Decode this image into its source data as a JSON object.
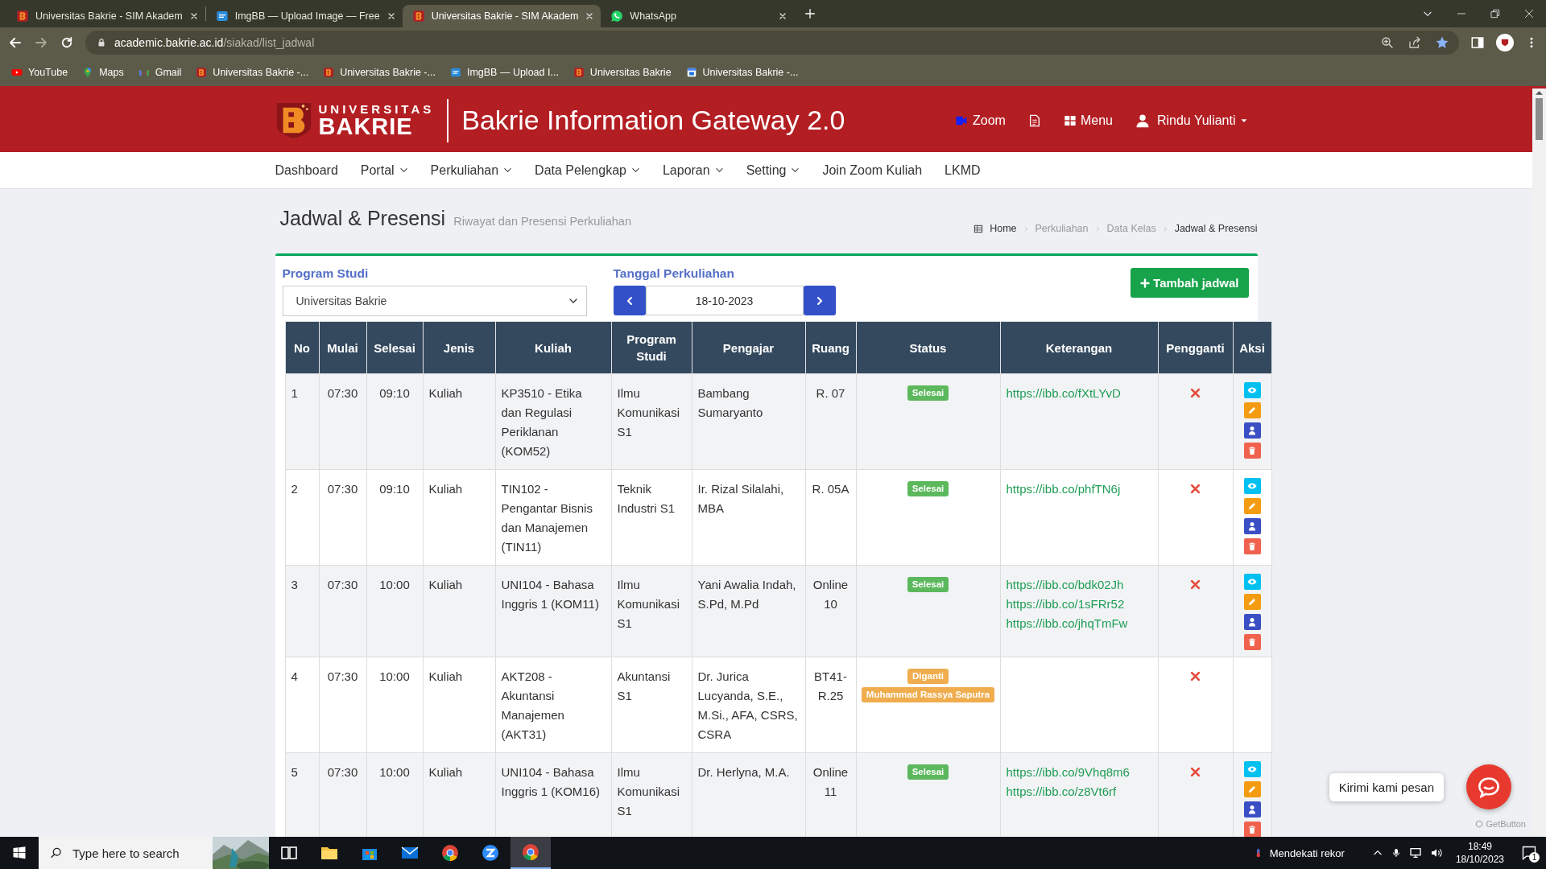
{
  "browser": {
    "tabs": [
      {
        "title": "Universitas Bakrie - SIM Akadem",
        "kind": "bakrie",
        "selected": false
      },
      {
        "title": "ImgBB — Upload Image — Free",
        "kind": "imgbb",
        "selected": false
      },
      {
        "title": "Universitas Bakrie - SIM Akadem",
        "kind": "bakrie",
        "selected": true
      },
      {
        "title": "WhatsApp",
        "kind": "whatsapp",
        "selected": false
      }
    ],
    "address": {
      "domain": "academic.bakrie.ac.id",
      "path": "/siakad/list_jadwal"
    },
    "bookmarks": [
      {
        "label": "YouTube",
        "kind": "youtube"
      },
      {
        "label": "Maps",
        "kind": "maps"
      },
      {
        "label": "Gmail",
        "kind": "gmail"
      },
      {
        "label": "Universitas Bakrie -...",
        "kind": "bakrie"
      },
      {
        "label": "Universitas Bakrie -...",
        "kind": "bakrie"
      },
      {
        "label": "ImgBB — Upload I...",
        "kind": "imgbb"
      },
      {
        "label": "Universitas Bakrie",
        "kind": "bakrie"
      },
      {
        "label": "Universitas Bakrie -...",
        "kind": "calendar"
      }
    ]
  },
  "header": {
    "logo": {
      "line1": "UNIVERSITAS",
      "line2": "BAKRIE"
    },
    "title": "Bakrie Information Gateway 2.0",
    "actions": [
      {
        "kind": "zoom",
        "label": "Zoom"
      },
      {
        "kind": "document"
      },
      {
        "kind": "menu",
        "label": "Menu"
      },
      {
        "kind": "user",
        "label": "Rindu Yulianti"
      }
    ]
  },
  "nav": [
    {
      "label": "Dashboard",
      "dropdown": false
    },
    {
      "label": "Portal",
      "dropdown": true
    },
    {
      "label": "Perkuliahan",
      "dropdown": true
    },
    {
      "label": "Data Pelengkap",
      "dropdown": true
    },
    {
      "label": "Laporan",
      "dropdown": true
    },
    {
      "label": "Setting",
      "dropdown": true
    },
    {
      "label": "Join Zoom Kuliah",
      "dropdown": false
    },
    {
      "label": "LKMD",
      "dropdown": false
    }
  ],
  "page": {
    "title": "Jadwal & Presensi",
    "subtitle": "Riwayat dan Presensi Perkuliahan",
    "breadcrumb": [
      "Home",
      "Perkuliahan",
      "Data Kelas",
      "Jadwal & Presensi"
    ]
  },
  "filters": {
    "program_studi": {
      "label": "Program Studi",
      "value": "Universitas Bakrie"
    },
    "tanggal": {
      "label": "Tanggal Perkuliahan",
      "value": "18-10-2023"
    },
    "add_button": "Tambah jadwal"
  },
  "table": {
    "columns": [
      "No",
      "Mulai",
      "Selesai",
      "Jenis",
      "Kuliah",
      "Program Studi",
      "Pengajar",
      "Ruang",
      "Status",
      "Keterangan",
      "Pengganti",
      "Aksi"
    ],
    "rows": [
      {
        "no": "1",
        "mulai": "07:30",
        "selesai": "09:10",
        "jenis": "Kuliah",
        "kuliah": "KP3510 - Etika dan Regulasi Periklanan (KOM52)",
        "program_studi": "Ilmu Komunikasi S1",
        "pengajar": "Bambang Sumaryanto",
        "ruang": "R. 07",
        "status": {
          "label": "Selesai",
          "kind": "done"
        },
        "links": [
          "https://ibb.co/fXtLYvD"
        ],
        "has_replacement": false,
        "actions": [
          {
            "kind": "view"
          },
          {
            "kind": "edit"
          },
          {
            "kind": "user"
          },
          {
            "kind": "delete"
          }
        ]
      },
      {
        "no": "2",
        "mulai": "07:30",
        "selesai": "09:10",
        "jenis": "Kuliah",
        "kuliah": "TIN102 - Pengantar Bisnis dan Manajemen (TIN11)",
        "program_studi": "Teknik Industri S1",
        "pengajar": "Ir. Rizal Silalahi, MBA",
        "ruang": "R. 05A",
        "status": {
          "label": "Selesai",
          "kind": "done"
        },
        "links": [
          "https://ibb.co/phfTN6j"
        ],
        "has_replacement": false,
        "actions": [
          {
            "kind": "view"
          },
          {
            "kind": "edit"
          },
          {
            "kind": "user"
          },
          {
            "kind": "delete"
          }
        ]
      },
      {
        "no": "3",
        "mulai": "07:30",
        "selesai": "10:00",
        "jenis": "Kuliah",
        "kuliah": "UNI104 - Bahasa Inggris 1 (KOM11)",
        "program_studi": "Ilmu Komunikasi S1",
        "pengajar": "Yani Awalia Indah, S.Pd, M.Pd",
        "ruang": "Online 10",
        "status": {
          "label": "Selesai",
          "kind": "done"
        },
        "links": [
          "https://ibb.co/bdk02Jh",
          "https://ibb.co/1sFRr52",
          "https://ibb.co/jhqTmFw"
        ],
        "has_replacement": false,
        "actions": [
          {
            "kind": "view"
          },
          {
            "kind": "edit"
          },
          {
            "kind": "user"
          },
          {
            "kind": "delete"
          }
        ]
      },
      {
        "no": "4",
        "mulai": "07:30",
        "selesai": "10:00",
        "jenis": "Kuliah",
        "kuliah": "AKT208 - Akuntansi Manajemen (AKT31)",
        "program_studi": "Akuntansi S1",
        "pengajar": "Dr. Jurica Lucyanda, S.E., M.Si., AFA, CSRS, CSRA",
        "ruang": "BT41-R.25",
        "status": {
          "label": "Diganti",
          "kind": "replaced",
          "note": "Muhammad Rassya Saputra"
        },
        "has_replacement": false
      },
      {
        "no": "5",
        "mulai": "07:30",
        "selesai": "10:00",
        "jenis": "Kuliah",
        "kuliah": "UNI104 - Bahasa Inggris 1 (KOM16)",
        "program_studi": "Ilmu Komunikasi S1",
        "pengajar": "Dr. Herlyna, M.A.",
        "ruang": "Online 11",
        "status": {
          "label": "Selesai",
          "kind": "done"
        },
        "links": [
          "https://ibb.co/9Vhq8m6",
          "https://ibb.co/z8Vt6rf"
        ],
        "has_replacement": false,
        "actions": [
          {
            "kind": "view"
          },
          {
            "kind": "edit"
          },
          {
            "kind": "user"
          },
          {
            "kind": "delete"
          }
        ]
      }
    ]
  },
  "chat": {
    "message": "Kirimi kami pesan",
    "brand": "GetButton"
  },
  "taskbar": {
    "search_placeholder": "Type here to search",
    "apps": [
      {
        "kind": "task_view",
        "selected": false
      },
      {
        "kind": "explorer",
        "selected": false
      },
      {
        "kind": "store",
        "selected": false
      },
      {
        "kind": "mail",
        "selected": false
      },
      {
        "kind": "chrome",
        "selected": false
      },
      {
        "kind": "zoom",
        "selected": false
      },
      {
        "kind": "chrome",
        "selected": true
      }
    ],
    "weather": "Mendekati rekor",
    "time": "18:49",
    "date": "18/10/2023",
    "notifications": "1"
  }
}
